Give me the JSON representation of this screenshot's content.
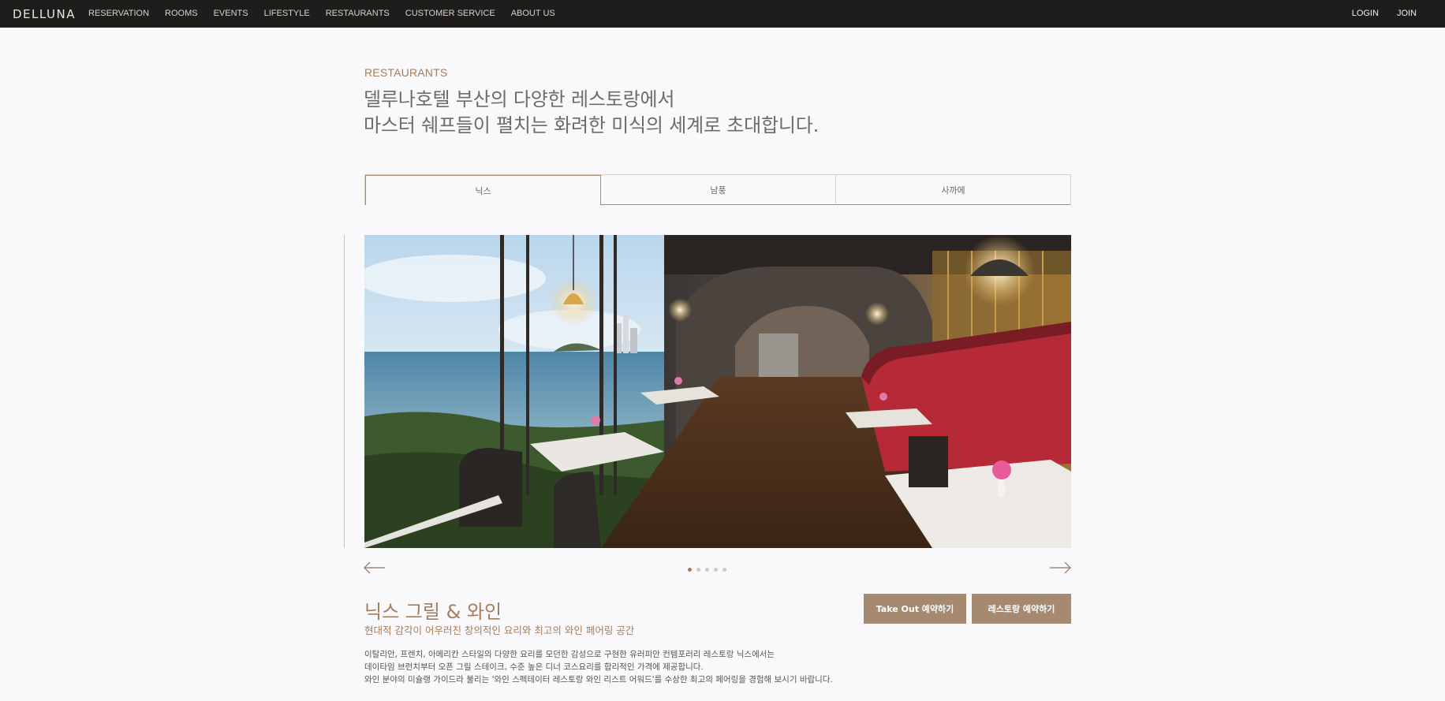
{
  "header": {
    "logo": "DELLUNA",
    "nav": [
      "RESERVATION",
      "ROOMS",
      "EVENTS",
      "LIFESTYLE",
      "RESTAURANTS",
      "CUSTOMER SERVICE",
      "ABOUT US"
    ],
    "login": "LOGIN",
    "join": "JOIN"
  },
  "page": {
    "section_label": "RESTAURANTS",
    "headline_line1": "델루나호텔 부산의 다양한 레스토랑에서",
    "headline_line2": "마스터 쉐프들이 펼치는 화려한 미식의 세계로 초대합니다."
  },
  "tabs": [
    {
      "label": "닉스",
      "active": true
    },
    {
      "label": "남풍",
      "active": false
    },
    {
      "label": "사까에",
      "active": false
    }
  ],
  "slider": {
    "image": "restaurant-interior-ocean-view",
    "slide_count": 5,
    "active_index": 0
  },
  "restaurant": {
    "name": "닉스 그릴 & 와인",
    "subtitle": "현대적 감각이 어우러진 창의적인 요리와 최고의 와인 페어링 공간",
    "desc_line1": "이탈리안, 프렌치, 아메리칸 스타일의 다양한 요리를 모던한 감성으로 구현한 유러피안 컨템포러리 레스토랑 닉스에서는",
    "desc_line2": "데이타임 브런치부터 오픈 그릴 스테이크, 수준 높은 디너 코스요리를 합리적인 가격에 제공합니다.",
    "desc_line3": "와인 분야의 미슐랭 가이드라 불리는 '와인 스펙테이터 레스토랑 와인 리스트 어워드'를 수상한 최고의 페어링을 경험해 보시기 바랍니다.",
    "btn_takeout": "Take Out 예약하기",
    "btn_reserve": "레스토랑 예약하기"
  },
  "colors": {
    "accent": "#a57e5d",
    "button": "#a58a71",
    "topbar": "#1f1d1b",
    "background": "#f9f8fb"
  }
}
